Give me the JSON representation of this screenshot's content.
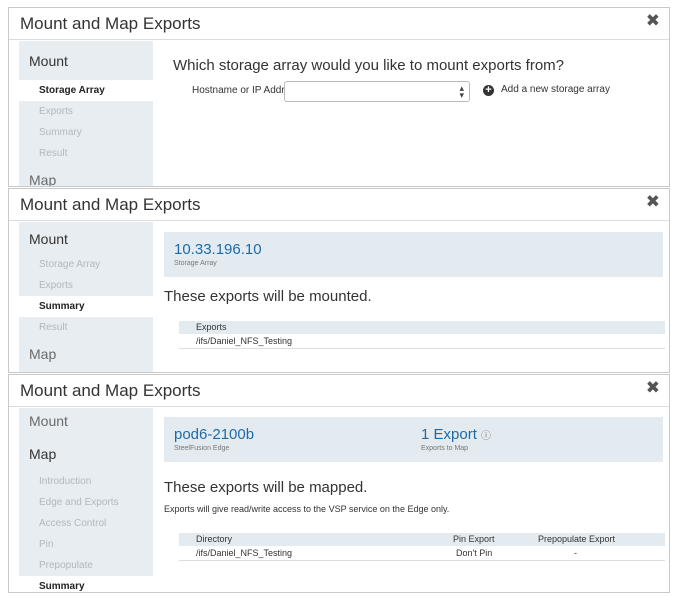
{
  "panel1": {
    "title": "Mount and Map Exports",
    "nav": {
      "mount": "Mount",
      "steps": [
        "Storage Array",
        "Exports",
        "Summary",
        "Result"
      ],
      "map": "Map"
    },
    "question": "Which storage array would you like to mount exports from?",
    "hostname_label": "Hostname or IP Address:",
    "hostname_value": "",
    "add_label": "Add a new storage array"
  },
  "panel2": {
    "title": "Mount and Map Exports",
    "nav": {
      "mount": "Mount",
      "steps": [
        "Storage Array",
        "Exports",
        "Summary",
        "Result"
      ],
      "map": "Map"
    },
    "array_ip": "10.33.196.10",
    "array_sub": "Storage Array",
    "heading": "These exports will be mounted.",
    "table": {
      "header": "Exports",
      "rows": [
        "/ifs/Daniel_NFS_Testing"
      ]
    }
  },
  "panel3": {
    "title": "Mount and Map Exports",
    "nav": {
      "mount": "Mount",
      "map": "Map",
      "steps": [
        "Introduction",
        "Edge and Exports",
        "Access Control",
        "Pin",
        "Prepopulate",
        "Summary"
      ]
    },
    "edge_name": "pod6-2100b",
    "edge_sub": "SteelFusion Edge",
    "export_count": "1 Export",
    "export_sub": "Exports to Map",
    "heading": "These exports will be mapped.",
    "note": "Exports will give read/write access to the VSP service on the Edge only.",
    "table": {
      "headers": [
        "Directory",
        "Pin Export",
        "Prepopulate Export"
      ],
      "rows": [
        [
          "/ifs/Daniel_NFS_Testing",
          "Don't Pin",
          "-"
        ]
      ]
    }
  },
  "colors": {
    "sidebar_bg": "#e8edf1",
    "accent_link": "#1e6aa6",
    "summary_bg": "#e3ebf1",
    "muted_step": "#b3b8bc"
  },
  "icons": {
    "close": "close-icon",
    "add": "plus-circle-icon",
    "info": "info-icon",
    "select": "select-arrows-icon"
  }
}
